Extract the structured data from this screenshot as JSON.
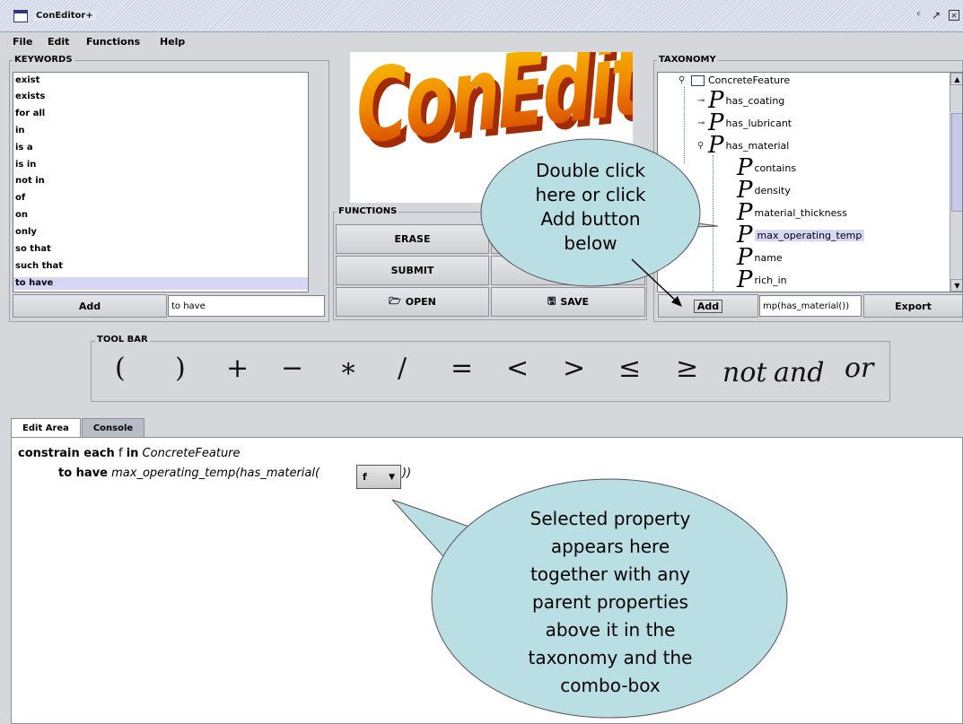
{
  "window": {
    "title": "ConEditor+"
  },
  "menu": [
    "File",
    "Edit",
    "Functions",
    "Help"
  ],
  "keywords": {
    "group_label": "KEYWORDS",
    "items": [
      "exist",
      "exists",
      "for all",
      "in",
      "is a",
      "is in",
      "not in",
      "of",
      "on",
      "only",
      "so that",
      "such that",
      "to have"
    ],
    "selected": "to have",
    "add_label": "Add",
    "field_value": "to have"
  },
  "logo": {
    "text": "ConEditor+"
  },
  "functions": {
    "group_label": "FUNCTIONS",
    "erase_label": "ERASE",
    "submit_label": "SUBMIT",
    "open_label": "OPEN",
    "save_label": "SAVE"
  },
  "taxonomy": {
    "group_label": "TAXONOMY",
    "root": "ConcreteFeature",
    "level1": [
      "has_coating",
      "has_lubricant",
      "has_material"
    ],
    "level2": [
      "contains",
      "density",
      "material_thickness",
      "max_operating_temp",
      "name",
      "rich_in"
    ],
    "selected": "max_operating_temp",
    "add_label": "Add",
    "field_value": "mp(has_material())",
    "export_label": "Export"
  },
  "toolbar": {
    "group_label": "TOOL BAR",
    "symbols": [
      "(",
      ")",
      "+",
      "−",
      "∗",
      "/",
      "=",
      "<",
      ">",
      "≤",
      "≥"
    ],
    "words": [
      "not",
      "and",
      "or"
    ]
  },
  "tabs": {
    "edit_area": "Edit Area",
    "console": "Console"
  },
  "editor": {
    "line1_kw1": "constrain each",
    "line1_var": "f",
    "line1_kw2": "in",
    "line1_class": "ConcreteFeature",
    "line2_kw": "to have",
    "line2_expr": "max_operating_temp(has_material(",
    "combo_value": "f",
    "line2_close": "))"
  },
  "callouts": {
    "top": [
      "Double click",
      "here or click",
      "Add button",
      "below"
    ],
    "bottom": [
      "Selected property",
      "appears here",
      "together with any",
      "parent properties",
      "above it in the",
      "taxonomy and the",
      "combo-box"
    ]
  },
  "colors": {
    "callout_fill": "#b9dfe5",
    "selection": "#d6d6f7"
  }
}
